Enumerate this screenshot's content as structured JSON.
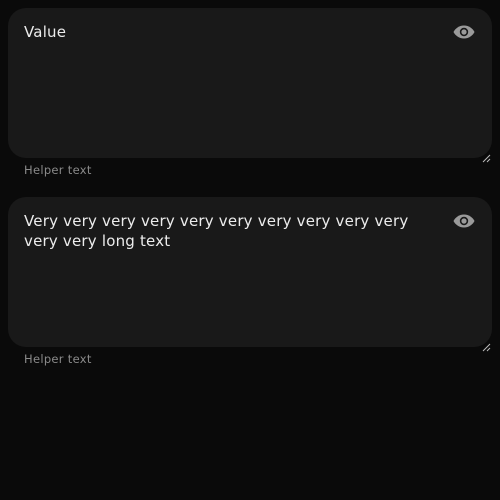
{
  "fields": [
    {
      "value": "Value",
      "helper_text": "Helper text",
      "trailing_icon": "eye-icon"
    },
    {
      "value": "Very very very very very very very very very very very very long text",
      "helper_text": "Helper text",
      "trailing_icon": "eye-icon"
    }
  ],
  "colors": {
    "background": "#0a0a0a",
    "field_fill": "#191919",
    "text": "#ececec",
    "helper_text": "#8a8a8a",
    "icon": "#9a9a9a"
  }
}
